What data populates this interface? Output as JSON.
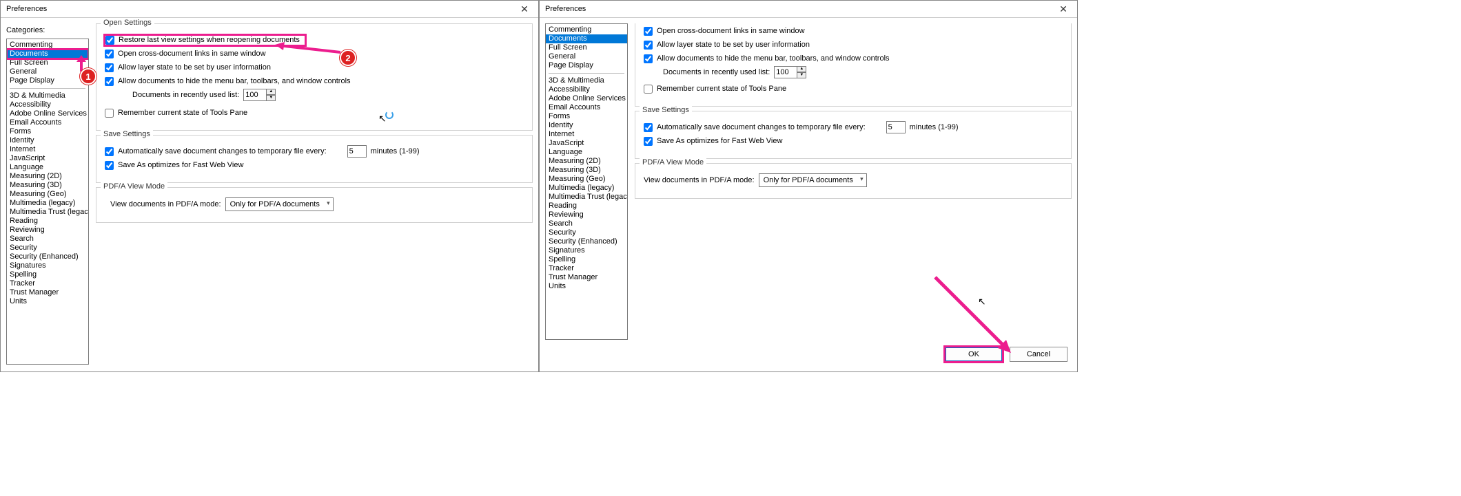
{
  "title": "Preferences",
  "categories_label": "Categories:",
  "cat_group1": [
    "Commenting",
    "Documents",
    "Full Screen",
    "General",
    "Page Display"
  ],
  "cat_group2": [
    "3D & Multimedia",
    "Accessibility",
    "Adobe Online Services",
    "Email Accounts",
    "Forms",
    "Identity",
    "Internet",
    "JavaScript",
    "Language",
    "Measuring (2D)",
    "Measuring (3D)",
    "Measuring (Geo)",
    "Multimedia (legacy)",
    "Multimedia Trust (legacy)",
    "Reading",
    "Reviewing",
    "Search",
    "Security",
    "Security (Enhanced)",
    "Signatures",
    "Spelling",
    "Tracker",
    "Trust Manager",
    "Units"
  ],
  "selected_category": "Documents",
  "open": {
    "title": "Open Settings",
    "restore": "Restore last view settings when reopening documents",
    "crosslinks": "Open cross-document links in same window",
    "layer": "Allow layer state to be set by user information",
    "hidemenu": "Allow documents to hide the menu bar, toolbars, and window controls",
    "recent_label": "Documents in recently used list:",
    "recent_value": "100",
    "remember_tools": "Remember current state of Tools Pane"
  },
  "save": {
    "title": "Save Settings",
    "autosave": "Automatically save document changes to temporary file every:",
    "autosave_value": "5",
    "autosave_unit": "minutes (1-99)",
    "fastweb": "Save As optimizes for Fast Web View"
  },
  "pdfa": {
    "title": "PDF/A View Mode",
    "label": "View documents in PDF/A mode:",
    "value": "Only for PDF/A documents"
  },
  "buttons": {
    "ok": "OK",
    "cancel": "Cancel"
  },
  "annot": {
    "b1": "1",
    "b2": "2"
  }
}
